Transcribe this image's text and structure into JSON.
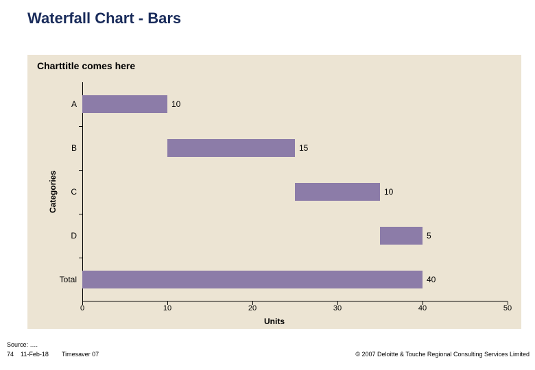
{
  "slide_title": "Waterfall Chart - Bars",
  "chart_data": {
    "type": "bar",
    "orientation": "horizontal",
    "title": "Charttitle comes here",
    "xlabel": "Units",
    "ylabel": "Categories",
    "xlim": [
      0,
      50
    ],
    "xticks": [
      0,
      10,
      20,
      30,
      40,
      50
    ],
    "categories": [
      "A",
      "B",
      "C",
      "D",
      "Total"
    ],
    "bars": [
      {
        "name": "A",
        "start": 0,
        "length": 10,
        "label": "10"
      },
      {
        "name": "B",
        "start": 10,
        "length": 15,
        "label": "15"
      },
      {
        "name": "C",
        "start": 25,
        "length": 10,
        "label": "10"
      },
      {
        "name": "D",
        "start": 35,
        "length": 5,
        "label": "5"
      },
      {
        "name": "Total",
        "start": 0,
        "length": 40,
        "label": "40"
      }
    ],
    "bar_color": "#8c7ca8",
    "panel_bg": "#ece4d3"
  },
  "footer": {
    "source": "Source: ….",
    "page": "74",
    "date": "11-Feb-18",
    "file": "Timesaver 07",
    "copyright": "© 2007 Deloitte & Touche Regional Consulting Services Limited"
  }
}
